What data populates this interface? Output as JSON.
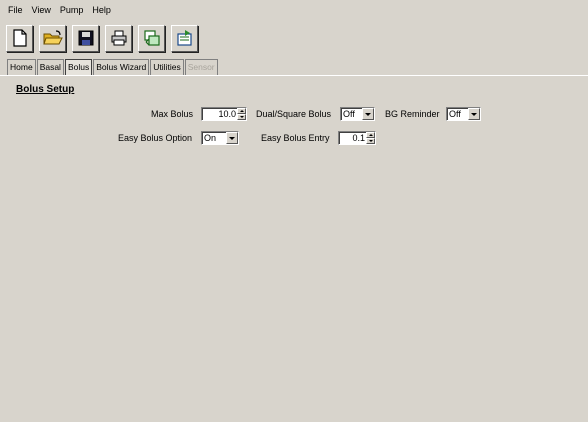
{
  "menu": [
    "File",
    "View",
    "Pump",
    "Help"
  ],
  "toolbar": {
    "icons": [
      "new-document-icon",
      "open-folder-icon",
      "save-disk-icon",
      "print-icon",
      "pump-transfer-icon",
      "export-icon"
    ]
  },
  "tabs": [
    {
      "label": "Home",
      "state": "normal"
    },
    {
      "label": "Basal",
      "state": "normal"
    },
    {
      "label": "Bolus",
      "state": "active"
    },
    {
      "label": "Bolus Wizard",
      "state": "normal"
    },
    {
      "label": "Utilities",
      "state": "normal"
    },
    {
      "label": "Sensor",
      "state": "disabled"
    }
  ],
  "section_title": "Bolus Setup",
  "fields": {
    "max_bolus": {
      "label": "Max Bolus",
      "value": "10.0"
    },
    "dual_square": {
      "label": "Dual/Square Bolus",
      "value": "Off"
    },
    "bg_reminder": {
      "label": "BG Reminder",
      "value": "Off"
    },
    "easy_bolus_option": {
      "label": "Easy Bolus Option",
      "value": "On"
    },
    "easy_bolus_entry": {
      "label": "Easy Bolus Entry",
      "value": "0.1"
    }
  }
}
